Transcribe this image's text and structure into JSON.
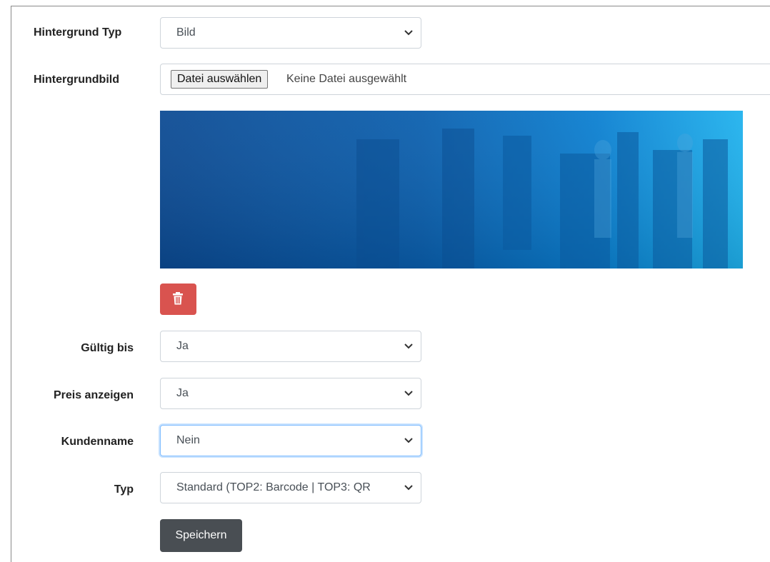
{
  "form": {
    "background_type": {
      "label": "Hintergrund Typ",
      "value": "Bild"
    },
    "background_image": {
      "label": "Hintergrundbild",
      "button_label": "Datei auswählen",
      "status_text": "Keine Datei ausgewählt"
    },
    "valid_until": {
      "label": "Gültig bis",
      "value": "Ja"
    },
    "show_price": {
      "label": "Preis anzeigen",
      "value": "Ja"
    },
    "customer_name": {
      "label": "Kundenname",
      "value": "Nein"
    },
    "type": {
      "label": "Typ",
      "value": "Standard (TOP2: Barcode | TOP3: QR"
    },
    "save_label": "Speichern"
  },
  "icons": {
    "delete": "trash-icon",
    "dropdown": "chevron-down-icon"
  },
  "colors": {
    "delete_button": "#d9534f",
    "save_button": "#494e53",
    "focus_border": "#80bdff",
    "banner_blue": "#0a5fae"
  }
}
